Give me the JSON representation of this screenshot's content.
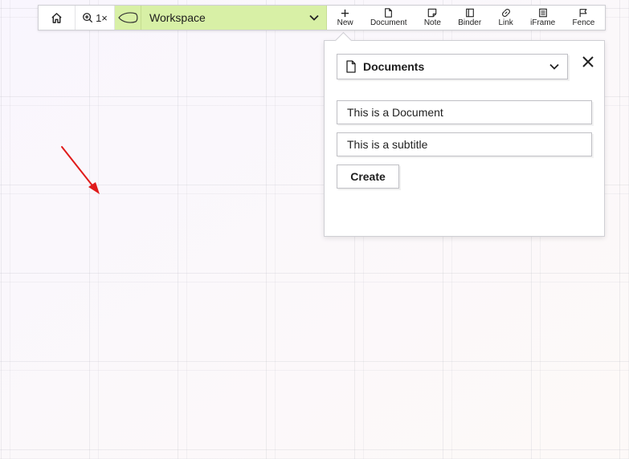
{
  "toolbar": {
    "zoom_label": "1×",
    "workspace": {
      "label": "Workspace",
      "color": "#d8f0a6"
    },
    "tools": [
      {
        "name": "new",
        "label": "New",
        "icon": "plus-icon"
      },
      {
        "name": "document",
        "label": "Document",
        "icon": "document-icon"
      },
      {
        "name": "note",
        "label": "Note",
        "icon": "note-icon"
      },
      {
        "name": "binder",
        "label": "Binder",
        "icon": "binder-icon"
      },
      {
        "name": "link",
        "label": "Link",
        "icon": "link-icon"
      },
      {
        "name": "iframe",
        "label": "iFrame",
        "icon": "iframe-icon"
      },
      {
        "name": "fence",
        "label": "Fence",
        "icon": "flag-icon"
      }
    ]
  },
  "panel": {
    "type_select": {
      "selected": "Documents",
      "icon": "document-icon"
    },
    "title_value": "This is a Document",
    "subtitle_value": "This is a subtitle",
    "create_label": "Create"
  },
  "colors": {
    "accent_arrow": "#e01b1b",
    "workspace_bg": "#d8f0a6"
  }
}
